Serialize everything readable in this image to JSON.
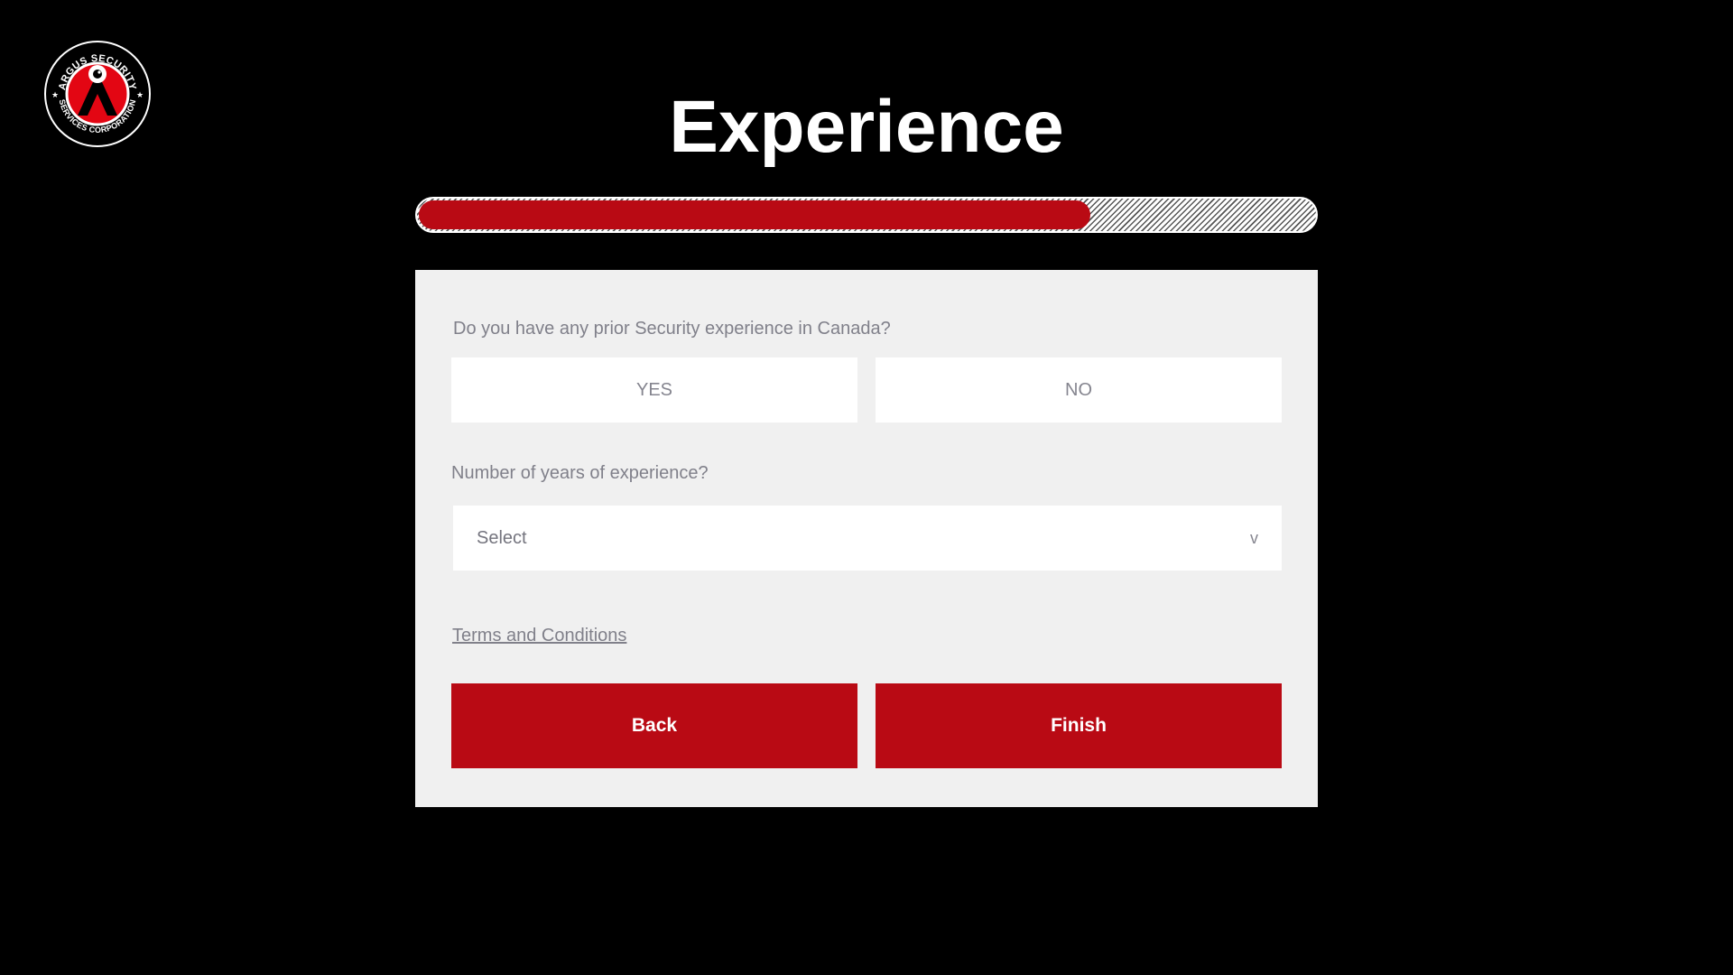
{
  "brand": {
    "logo_text_top": "ARGUS SECURITY",
    "logo_text_bottom": "SERVICES CORPORATION",
    "accent_color": "#b90a14"
  },
  "page": {
    "title": "Experience"
  },
  "progress": {
    "fraction": 0.75
  },
  "form": {
    "prior_experience": {
      "question": "Do you have any prior Security experience in Canada?",
      "yes_label": "YES",
      "no_label": "NO"
    },
    "years_experience": {
      "question": "Number of years of experience?",
      "selected_value": "Select",
      "chevron": "v"
    },
    "terms_link": "Terms and Conditions",
    "back_label": "Back",
    "finish_label": "Finish"
  }
}
